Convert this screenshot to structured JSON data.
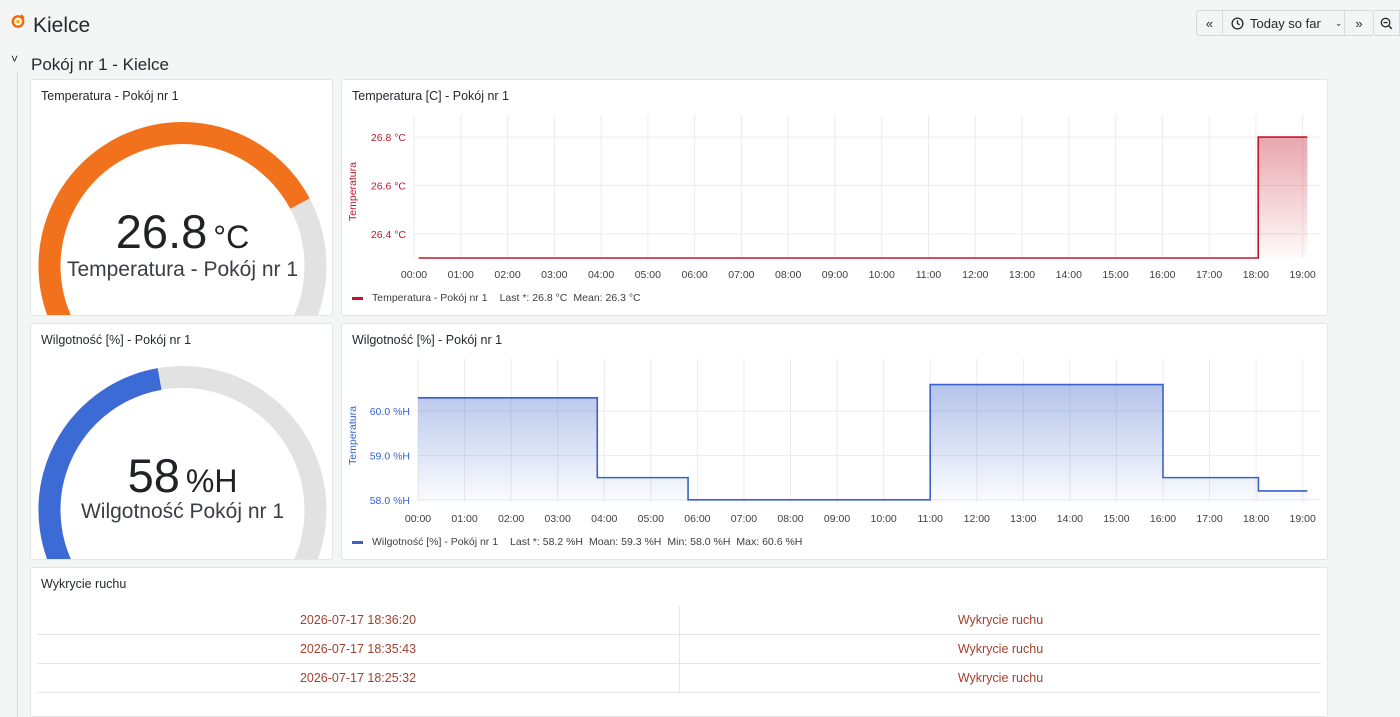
{
  "colors": {
    "temperature": "#c4162a",
    "humidity": "#3a62c8",
    "gauge_orange": "#f2711c",
    "gauge_blue": "#3d6bd6",
    "gauge_track": "#e2e2e2"
  },
  "header": {
    "title": "Kielce",
    "logo_icon": "grafana-logo-icon",
    "back_icon": "chevron-double-left-icon",
    "clock_icon": "clock-icon",
    "time_range": "Today so far",
    "forward_icon": "chevron-double-right-icon",
    "zoom_icon": "zoom-out-icon"
  },
  "row": {
    "title": "Pokój nr 1 - Kielce"
  },
  "temp_gauge": {
    "panel_title": "Temperatura - Pokój nr 1",
    "value": "26.8",
    "unit": "°C",
    "label": "Temperatura - Pokój nr 1",
    "fill_fraction": 0.75
  },
  "temp_chart": {
    "panel_title": "Temperatura [C] - Pokój nr 1",
    "legend": {
      "series": "Temperatura - Pokój nr 1",
      "last": "Last *: 26.8 °C",
      "mean": "Mean: 26.3 °C"
    },
    "chart_data": {
      "type": "area",
      "ylabel": "Temperatura",
      "x_ticks": [
        "00:00",
        "01:00",
        "02:00",
        "03:00",
        "04:00",
        "05:00",
        "06:00",
        "07:00",
        "08:00",
        "09:00",
        "10:00",
        "11:00",
        "12:00",
        "13:00",
        "14:00",
        "15:00",
        "16:00",
        "17:00",
        "18:00",
        "19:00"
      ],
      "y_ticks": [
        "26.4 °C",
        "26.6 °C",
        "26.8 °C"
      ],
      "y_tick_values": [
        26.4,
        26.6,
        26.8
      ],
      "ylim": [
        26.3,
        26.85
      ],
      "xlim": [
        0,
        19.2
      ],
      "series": [
        {
          "name": "Temperatura - Pokój nr 1",
          "points": [
            [
              0.1,
              26.3
            ],
            [
              18.05,
              26.3
            ],
            [
              18.05,
              26.8
            ],
            [
              19.1,
              26.8
            ]
          ]
        }
      ]
    }
  },
  "hum_gauge": {
    "panel_title": "Wilgotność [%] - Pokój nr 1",
    "value": "58",
    "unit": "%H",
    "label": "Wilgotność Pokój nr 1",
    "fill_fraction": 0.46
  },
  "hum_chart": {
    "panel_title": "Wilgotność [%] - Pokój nr 1",
    "legend": {
      "series": "Wilgotność [%] - Pokój nr 1",
      "last": "Last *: 58.2 %H",
      "mean": "Moan: 59.3 %H",
      "min": "Min: 58.0 %H",
      "max": "Max: 60.6 %H"
    },
    "chart_data": {
      "type": "area",
      "ylabel": "Temperatura",
      "x_ticks": [
        "00:00",
        "01:00",
        "02:00",
        "03:00",
        "04:00",
        "05:00",
        "06:00",
        "07:00",
        "08:00",
        "09:00",
        "10:00",
        "11:00",
        "12:00",
        "13:00",
        "14:00",
        "15:00",
        "16:00",
        "17:00",
        "18:00",
        "19:00"
      ],
      "y_ticks": [
        "58.0 %H",
        "59.0 %H",
        "60.0 %H"
      ],
      "y_tick_values": [
        58.0,
        59.0,
        60.0
      ],
      "ylim": [
        57.95,
        60.95
      ],
      "xlim": [
        0,
        19.2
      ],
      "series": [
        {
          "name": "Wilgotność [%] - Pokój nr 1",
          "points": [
            [
              0.0,
              60.3
            ],
            [
              3.85,
              60.3
            ],
            [
              3.85,
              58.5
            ],
            [
              5.8,
              58.5
            ],
            [
              5.8,
              58.0
            ],
            [
              11.0,
              58.0
            ],
            [
              11.0,
              60.6
            ],
            [
              16.0,
              60.6
            ],
            [
              16.0,
              58.5
            ],
            [
              18.05,
              58.5
            ],
            [
              18.05,
              58.2
            ],
            [
              19.1,
              58.2
            ]
          ]
        }
      ]
    }
  },
  "motion": {
    "panel_title": "Wykrycie ruchu",
    "rows": [
      {
        "time": "2026-07-17 18:36:20",
        "event": "Wykrycie ruchu"
      },
      {
        "time": "2026-07-17 18:35:43",
        "event": "Wykrycie ruchu"
      },
      {
        "time": "2026-07-17 18:25:32",
        "event": "Wykrycie ruchu"
      }
    ]
  }
}
